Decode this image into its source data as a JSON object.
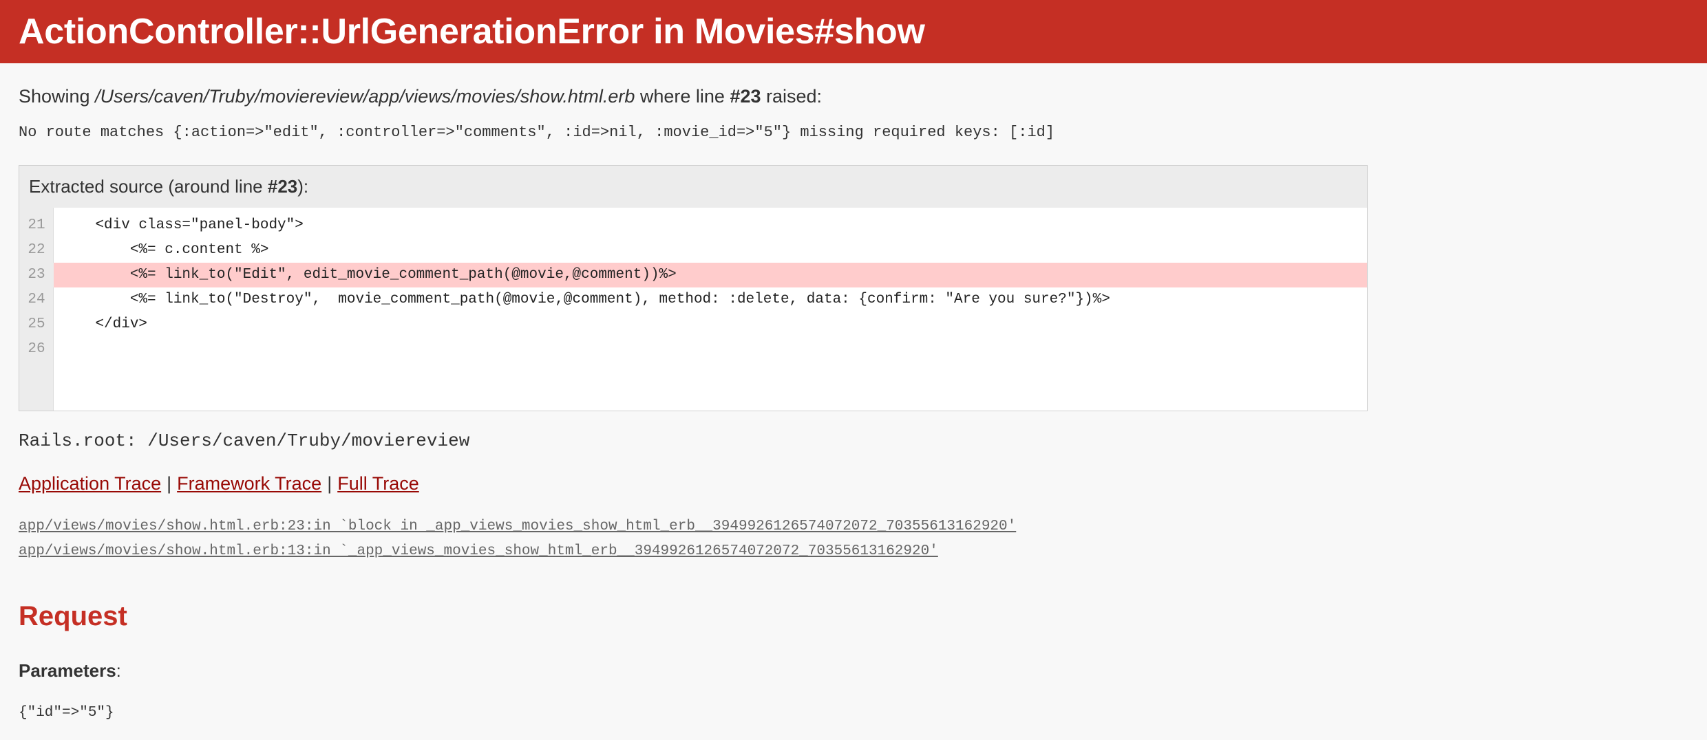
{
  "header": {
    "title": "ActionController::UrlGenerationError in Movies#show"
  },
  "showing": {
    "prefix": "Showing ",
    "path": "/Users/caven/Truby/moviereview/app/views/movies/show.html.erb",
    "middle": " where line ",
    "line": "#23",
    "suffix": " raised:"
  },
  "error_message": "No route matches {:action=>\"edit\", :controller=>\"comments\", :id=>nil, :movie_id=>\"5\"} missing required keys: [:id]",
  "source": {
    "header_prefix": "Extracted source (around line ",
    "header_line": "#23",
    "header_suffix": "):",
    "lines": [
      {
        "number": "21",
        "code": "    <div class=\"panel-body\">"
      },
      {
        "number": "22",
        "code": "        <%= c.content %>"
      },
      {
        "number": "23",
        "code": "        <%= link_to(\"Edit\", edit_movie_comment_path(@movie,@comment))%>"
      },
      {
        "number": "24",
        "code": "        <%= link_to(\"Destroy\",  movie_comment_path(@movie,@comment), method: :delete, data: {confirm: \"Are you sure?\"})%>"
      },
      {
        "number": "25",
        "code": "    </div>"
      },
      {
        "number": "26",
        "code": ""
      }
    ]
  },
  "rails_root": "Rails.root: /Users/caven/Truby/moviereview",
  "trace_links": {
    "application": "Application Trace",
    "framework": "Framework Trace",
    "full": "Full Trace",
    "separator": "|"
  },
  "traces": [
    "app/views/movies/show.html.erb:23:in `block in _app_views_movies_show_html_erb__3949926126574072072_70355613162920'",
    "app/views/movies/show.html.erb:13:in `_app_views_movies_show_html_erb__3949926126574072072_70355613162920'"
  ],
  "request": {
    "title": "Request",
    "params_label": "Parameters",
    "params_colon": ":",
    "params_value": "{\"id\"=>\"5\"}"
  },
  "colors": {
    "header_bg": "#c52f24",
    "highlight_line": "#ffcccc",
    "link": "#980905"
  }
}
